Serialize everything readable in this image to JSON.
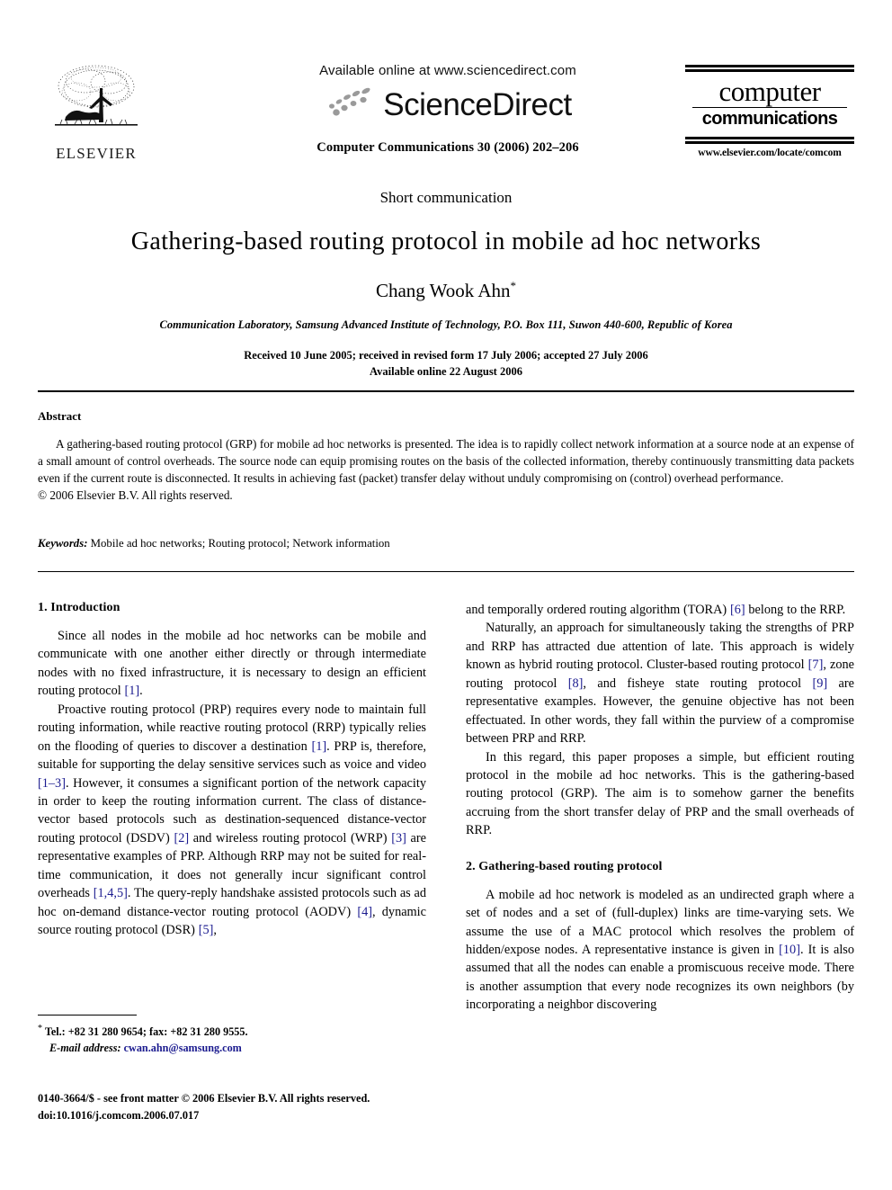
{
  "masthead": {
    "publisher_name": "ELSEVIER",
    "publisher_logo_icon": "elsevier-tree-logo",
    "available_online": "Available online at www.sciencedirect.com",
    "sciencedirect_wordmark": "ScienceDirect",
    "sciencedirect_swoosh_icon": "sciencedirect-swoosh-icon",
    "journal_reference": "Computer Communications 30 (2006) 202–206",
    "journal_logo_line1": "computer",
    "journal_logo_line2": "communications",
    "journal_url": "www.elsevier.com/locate/comcom"
  },
  "title_block": {
    "article_type": "Short communication",
    "title": "Gathering-based routing protocol in mobile ad hoc networks",
    "author": "Chang Wook Ahn",
    "author_footnote_marker": "*",
    "affiliation": "Communication Laboratory, Samsung Advanced Institute of Technology, P.O. Box 111, Suwon 440-600, Republic of Korea",
    "received_line": "Received 10 June 2005; received in revised form 17 July 2006; accepted 27 July 2006",
    "available_online_line": "Available online 22 August 2006"
  },
  "abstract": {
    "heading": "Abstract",
    "body": "A gathering-based routing protocol (GRP) for mobile ad hoc networks is presented. The idea is to rapidly collect network information at a source node at an expense of a small amount of control overheads. The source node can equip promising routes on the basis of the collected information, thereby continuously transmitting data packets even if the current route is disconnected. It results in achieving fast (packet) transfer delay without unduly compromising on (control) overhead performance.",
    "copyright": "© 2006 Elsevier B.V. All rights reserved."
  },
  "keywords": {
    "label": "Keywords:",
    "value": "Mobile ad hoc networks; Routing protocol; Network information"
  },
  "body": {
    "section1_heading": "1. Introduction",
    "section2_heading": "2. Gathering-based routing protocol",
    "left_p1_a": "Since all nodes in the mobile ad hoc networks can be mobile and communicate with one another either directly or through intermediate nodes with no fixed infrastructure, it is necessary to design an efficient routing protocol ",
    "left_p1_cite1": "[1]",
    "left_p1_b": ".",
    "left_p2_a": "Proactive routing protocol (PRP) requires every node to maintain full routing information, while reactive routing protocol (RRP) typically relies on the flooding of queries to discover a destination ",
    "left_p2_cite1": "[1]",
    "left_p2_b": ". PRP is, therefore, suitable for supporting the delay sensitive services such as voice and video ",
    "left_p2_cite2": "[1–3]",
    "left_p2_c": ". However, it consumes a significant portion of the network capacity in order to keep the routing information current. The class of distance-vector based protocols such as destination-sequenced distance-vector routing protocol (DSDV) ",
    "left_p2_cite3": "[2]",
    "left_p2_d": " and wireless routing protocol (WRP) ",
    "left_p2_cite4": "[3]",
    "left_p2_e": " are representative examples of PRP. Although RRP may not be suited for real-time communication, it does not generally incur significant control overheads ",
    "left_p2_cite5": "[1,4,5]",
    "left_p2_f": ". The query-reply handshake assisted protocols such as ad hoc on-demand distance-vector routing protocol (AODV) ",
    "left_p2_cite6": "[4]",
    "left_p2_g": ", dynamic source routing protocol (DSR) ",
    "left_p2_cite7": "[5]",
    "left_p2_h": ",",
    "right_p1_a": "and temporally ordered routing algorithm (TORA) ",
    "right_p1_cite1": "[6]",
    "right_p1_b": " belong to the RRP.",
    "right_p2_a": "Naturally, an approach for simultaneously taking the strengths of PRP and RRP has attracted due attention of late. This approach is widely known as hybrid routing protocol. Cluster-based routing protocol ",
    "right_p2_cite1": "[7]",
    "right_p2_b": ", zone routing protocol ",
    "right_p2_cite2": "[8]",
    "right_p2_c": ", and fisheye state routing protocol ",
    "right_p2_cite3": "[9]",
    "right_p2_d": " are representative examples. However, the genuine objective has not been effectuated. In other words, they fall within the purview of a compromise between PRP and RRP.",
    "right_p3": "In this regard, this paper proposes a simple, but efficient routing protocol in the mobile ad hoc networks. This is the gathering-based routing protocol (GRP). The aim is to somehow garner the benefits accruing from the short transfer delay of PRP and the small overheads of RRP.",
    "right_p4_a": "A mobile ad hoc network is modeled as an undirected graph where a set of nodes and a set of (full-duplex) links are time-varying sets. We assume the use of a MAC protocol which resolves the problem of hidden/expose nodes. A representative instance is given in ",
    "right_p4_cite1": "[10]",
    "right_p4_b": ". It is also assumed that all the nodes can enable a promiscuous receive mode. There is another assumption that every node recognizes its own neighbors (by incorporating a neighbor discovering"
  },
  "footnote": {
    "marker": "*",
    "tel_fax": "Tel.: +82 31 280 9654; fax: +82 31 280 9555.",
    "email_label": "E-mail address:",
    "email_address": "cwan.ahn@samsung.com"
  },
  "page_footer": {
    "front_matter": "0140-3664/$ - see front matter © 2006 Elsevier B.V. All rights reserved.",
    "doi": "doi:10.1016/j.comcom.2006.07.017"
  },
  "colors": {
    "citation_link": "#1b1b8f",
    "text": "#000000",
    "background": "#ffffff"
  }
}
